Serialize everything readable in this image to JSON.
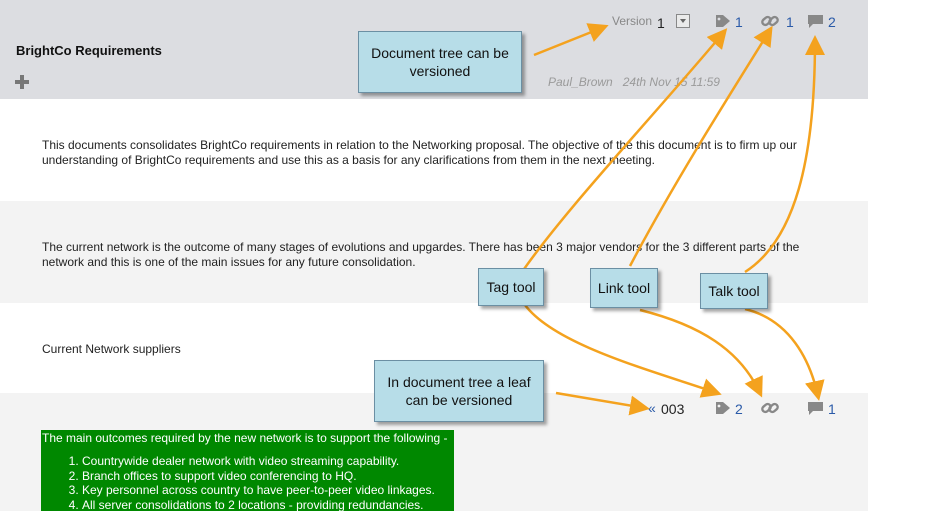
{
  "header": {
    "title": "BrightCo Requirements",
    "version_label": "Version",
    "version_number": "1",
    "tag_count": "1",
    "link_count": "1",
    "talk_count": "2",
    "author": "Paul_Brown",
    "date": "24th Nov 15 11:59"
  },
  "paragraphs": {
    "p1": "This documents consolidates BrightCo requirements in relation to the Networking proposal. The objective of the this document is to firm up our understanding of BrightCo requirements and use this as a basis for any clarifications from them in the next meeting.",
    "p2": "The current network is the outcome of many stages of evolutions and upgardes. There has been 3 major vendors for the 3 different parts of the network and this is one of the main issues for any future consolidation.",
    "p3": "Current Network suppliers"
  },
  "leaf": {
    "version_prefix": "«",
    "version_number": "003",
    "tag_count": "2",
    "talk_count": "1",
    "intro": "The main outcomes required by the new network is to support the following -",
    "items": [
      "Countrywide dealer network with video streaming capability.",
      "Branch offices to support video conferencing to HQ.",
      "Key personnel across country to have peer-to-peer video linkages.",
      "All server consolidations to 2 locations - providing redundancies."
    ]
  },
  "callouts": {
    "tree": "Document tree can be versioned",
    "tag": "Tag tool",
    "link": "Link tool",
    "talk": "Talk tool",
    "leaf": "In document tree a leaf can be versioned"
  },
  "colors": {
    "header_bg": "#dcdde1",
    "count_blue": "#2a5aa8",
    "callout_bg": "#b7dde8",
    "arrow_orange": "#f4a21e",
    "outcome_green": "#008800"
  },
  "icons": {
    "add": "plus-icon",
    "dropdown": "dropdown-square-icon",
    "tag": "tag-icon",
    "link": "link-chain-icon",
    "talk": "speech-bubble-icon",
    "version": "double-chevron-left-icon"
  }
}
